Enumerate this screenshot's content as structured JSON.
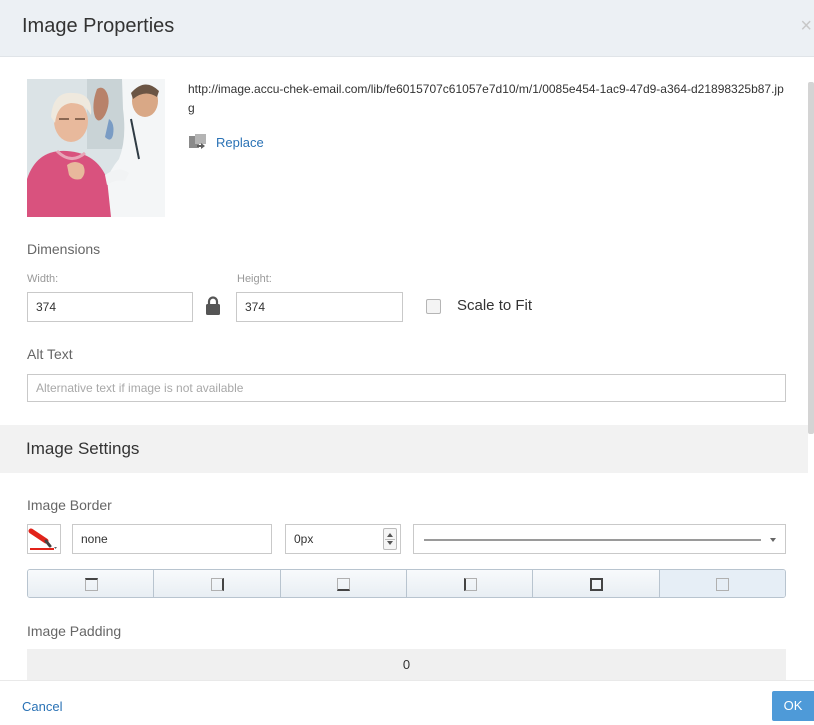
{
  "dialog": {
    "title": "Image Properties",
    "close_glyph": "×"
  },
  "image": {
    "url": "http://image.accu-chek-email.com/lib/fe6015707c61057e7d10/m/1/0085e454-1ac9-47d9-a364-d21898325b87.jpg",
    "replace_label": "Replace",
    "replace_icon": "replace-image-icon"
  },
  "dimensions": {
    "heading": "Dimensions",
    "width_label": "Width:",
    "width_value": "374",
    "height_label": "Height:",
    "height_value": "374",
    "lock_icon": "lock-icon",
    "scale_label": "Scale to Fit",
    "scale_checked": false
  },
  "alt": {
    "heading": "Alt Text",
    "value": "",
    "placeholder": "Alternative text if image is not available"
  },
  "settings": {
    "heading": "Image Settings"
  },
  "border": {
    "heading": "Image Border",
    "color_icon": "pen-color-icon",
    "color_value": "#e2231a",
    "style_value": "none",
    "width_value": "0px",
    "line_style": "solid",
    "sides": [
      "top",
      "right",
      "bottom",
      "left",
      "all",
      "none"
    ],
    "selected_side": "none"
  },
  "padding": {
    "heading": "Image Padding",
    "value": "0"
  },
  "footer": {
    "cancel_label": "Cancel",
    "ok_label": "OK"
  },
  "colors": {
    "accent": "#4e9ad8",
    "link": "#2a72b5",
    "header_bg": "#ecf0f4"
  }
}
